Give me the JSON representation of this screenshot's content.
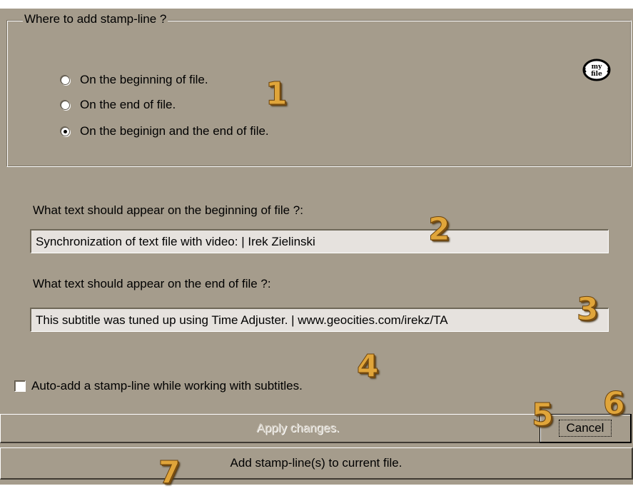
{
  "group": {
    "legend": "Where to add stamp-line ?",
    "options": [
      {
        "label": "On the beginning of file.",
        "selected": false
      },
      {
        "label": "On the end of file.",
        "selected": false
      },
      {
        "label": "On the beginign and the end of file.",
        "selected": true
      }
    ],
    "logo_text": "my file"
  },
  "begin_label": "What text should appear on the beginning of file ?:",
  "begin_value": "Synchronization of text file with video: | Irek Zielinski",
  "end_label": "What text should appear on the end of file ?:",
  "end_value": "This subtitle was tuned up using Time Adjuster. | www.geocities.com/irekz/TA",
  "auto_add": {
    "label": "Auto-add a stamp-line while working with subtitles.",
    "checked": false
  },
  "buttons": {
    "apply": "Apply changes.",
    "cancel": "Cancel",
    "add": "Add stamp-line(s) to current file."
  },
  "callouts": [
    "1",
    "2",
    "3",
    "4",
    "5",
    "6",
    "7"
  ],
  "colors": {
    "dialog_bg": "#a59c8c",
    "field_bg": "#e6e2de",
    "callout": "#e0a53a"
  }
}
